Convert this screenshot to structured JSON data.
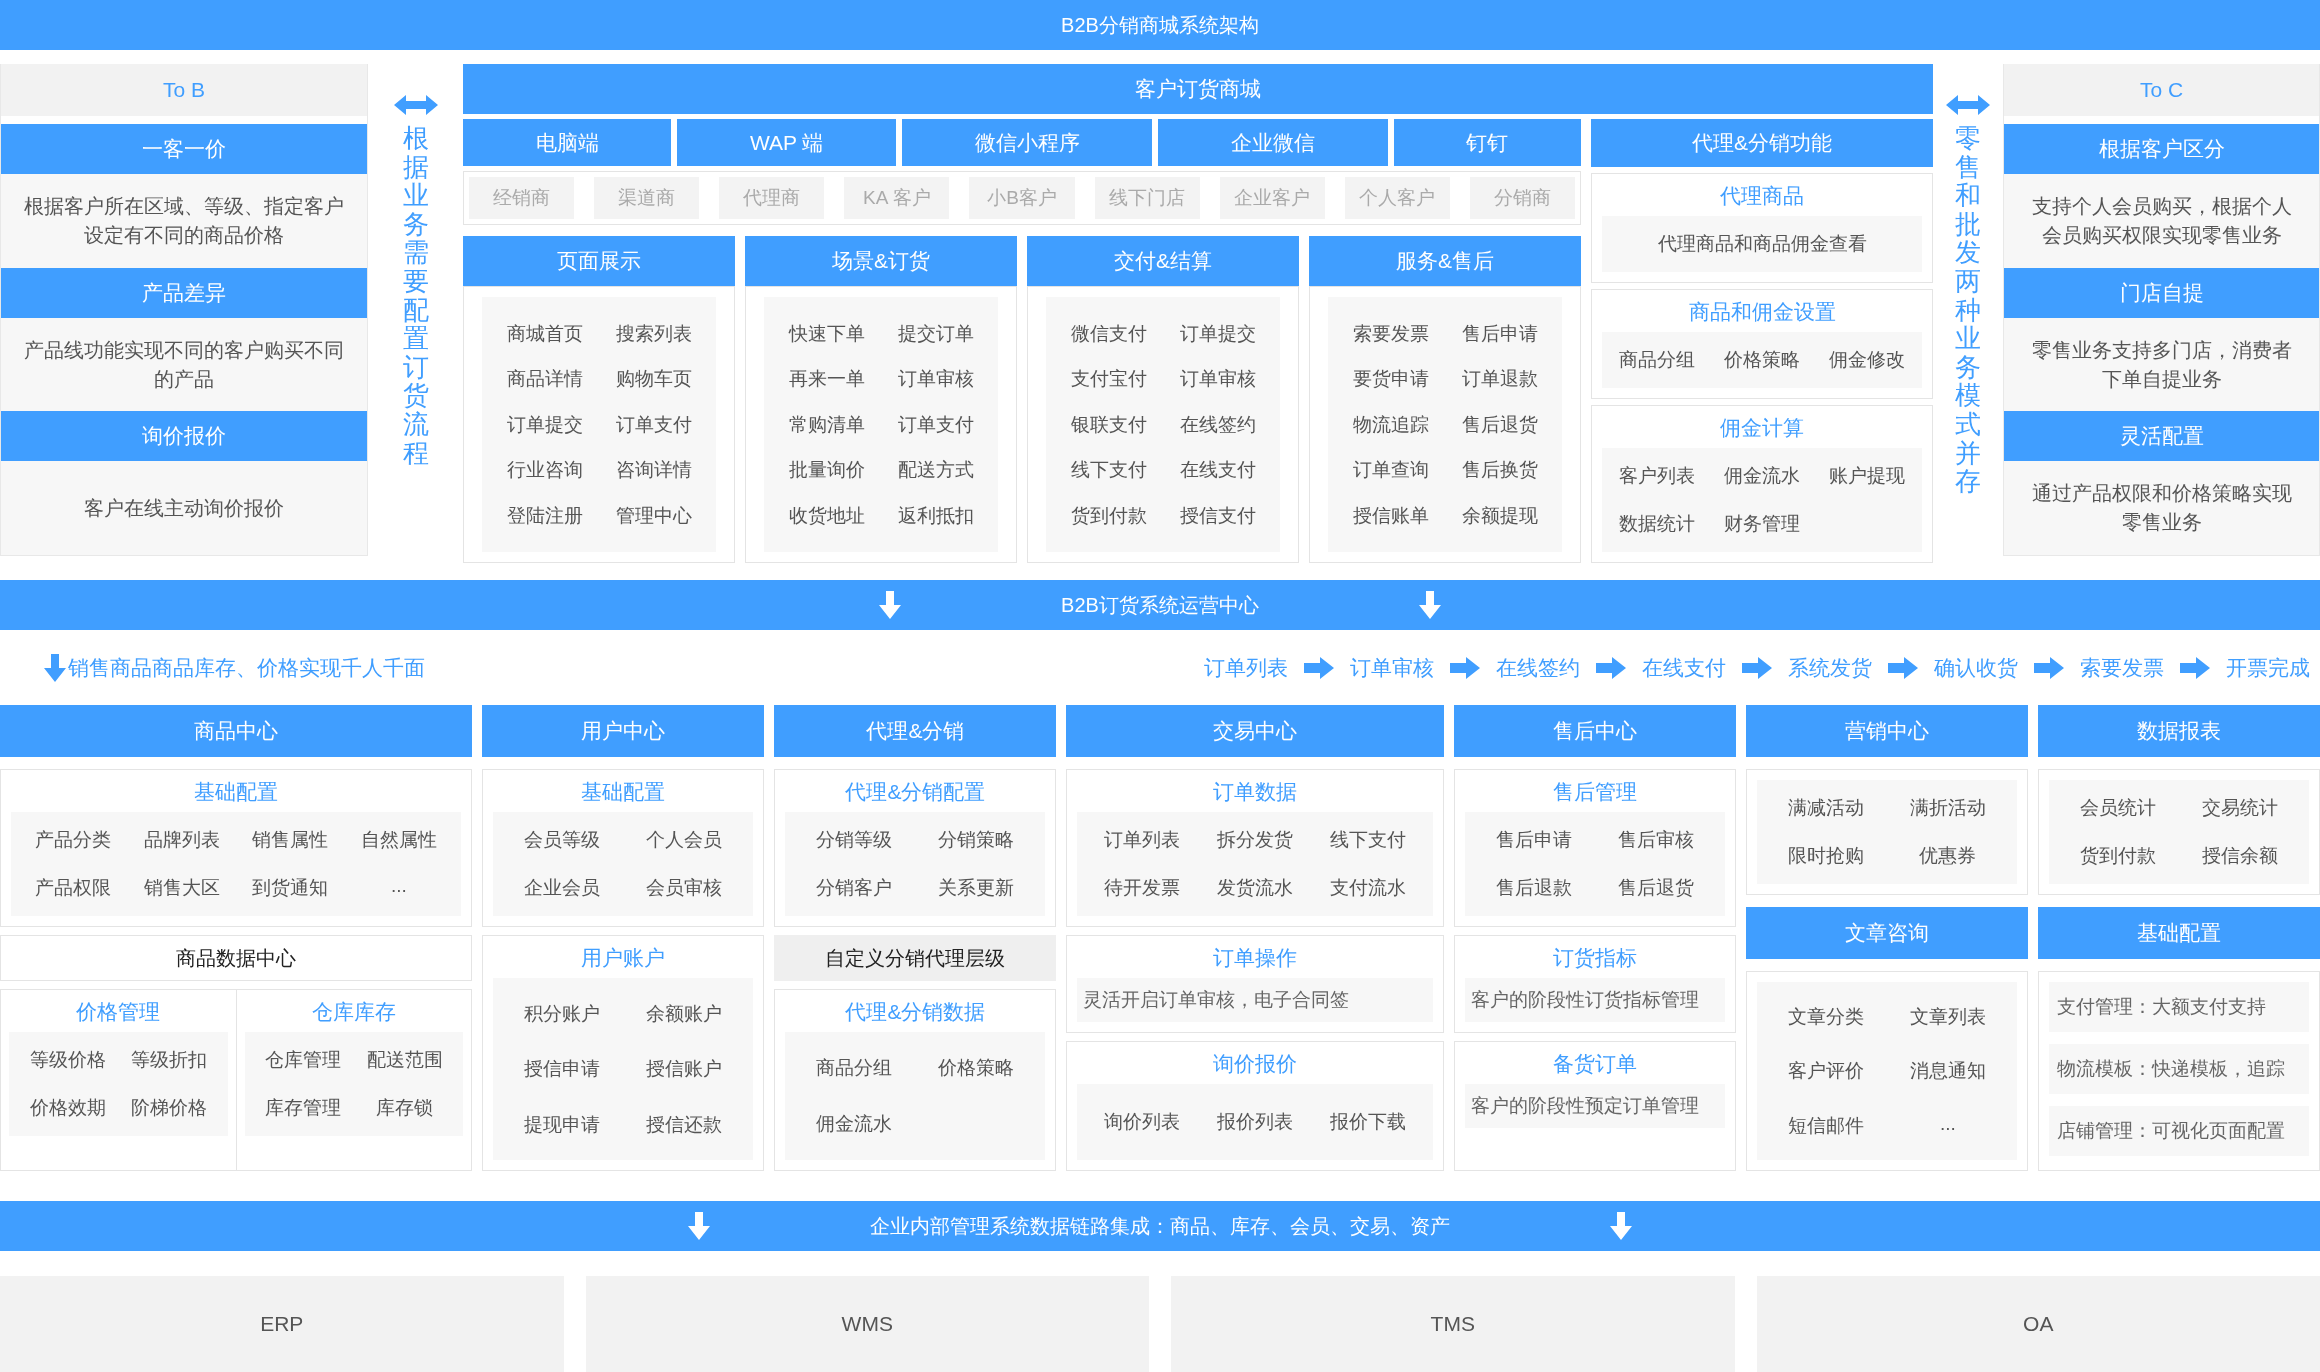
{
  "title": "B2B分销商城系统架构",
  "to_b": {
    "header": "To B",
    "sections": [
      {
        "title": "一客一价",
        "text": "根据客户所在区域、等级、指定客户设定有不同的商品价格"
      },
      {
        "title": "产品差异",
        "text": "产品线功能实现不同的客户购买不同的产品"
      },
      {
        "title": "询价报价",
        "text": "客户在线主动询价报价"
      }
    ]
  },
  "left_note": "根据业务需要配置订货流程",
  "mall": {
    "title": "客户订货商城",
    "channels": [
      "电脑端",
      "WAP 端",
      "微信小程序",
      "企业微信",
      "钉钉"
    ],
    "customer_types": [
      "经销商",
      "渠道商",
      "代理商",
      "KA 客户",
      "小B客户",
      "线下门店",
      "企业客户",
      "个人客户",
      "分销商"
    ],
    "modules": [
      {
        "title": "页面展示",
        "rows": [
          [
            "商城首页",
            "搜索列表"
          ],
          [
            "商品详情",
            "购物车页"
          ],
          [
            "订单提交",
            "订单支付"
          ],
          [
            "行业咨询",
            "咨询详情"
          ],
          [
            "登陆注册",
            "管理中心"
          ]
        ]
      },
      {
        "title": "场景&订货",
        "rows": [
          [
            "快速下单",
            "提交订单"
          ],
          [
            "再来一单",
            "订单审核"
          ],
          [
            "常购清单",
            "订单支付"
          ],
          [
            "批量询价",
            "配送方式"
          ],
          [
            "收货地址",
            "返利抵扣"
          ]
        ]
      },
      {
        "title": "交付&结算",
        "rows": [
          [
            "微信支付",
            "订单提交"
          ],
          [
            "支付宝付",
            "订单审核"
          ],
          [
            "银联支付",
            "在线签约"
          ],
          [
            "线下支付",
            "在线支付"
          ],
          [
            "货到付款",
            "授信支付"
          ]
        ]
      },
      {
        "title": "服务&售后",
        "rows": [
          [
            "索要发票",
            "售后申请"
          ],
          [
            "要货申请",
            "订单退款"
          ],
          [
            "物流追踪",
            "售后退货"
          ],
          [
            "订单查询",
            "售后换货"
          ],
          [
            "授信账单",
            "余额提现"
          ]
        ]
      }
    ],
    "agent": {
      "title": "代理&分销功能",
      "groups": [
        {
          "title": "代理商品",
          "rows": [
            [
              "代理商品和商品佣金查看"
            ]
          ]
        },
        {
          "title": "商品和佣金设置",
          "rows": [
            [
              "商品分组",
              "价格策略",
              "佣金修改"
            ]
          ]
        },
        {
          "title": "佣金计算",
          "rows": [
            [
              "客户列表",
              "佣金流水",
              "账户提现"
            ],
            [
              "数据统计",
              "财务管理"
            ]
          ]
        }
      ]
    }
  },
  "right_note": "零售和批发两种业务模式并存",
  "to_c": {
    "header": "To C",
    "sections": [
      {
        "title": "根据客户区分",
        "text": "支持个人会员购买，根据个人会员购买权限实现零售业务"
      },
      {
        "title": "门店自提",
        "text": "零售业务支持多门店，消费者下单自提业务"
      },
      {
        "title": "灵活配置",
        "text": "通过产品权限和价格策略实现零售业务"
      }
    ]
  },
  "ops_bar": "B2B订货系统运营中心",
  "flow": {
    "note": "销售商品商品库存、价格实现千人千面",
    "steps": [
      "订单列表",
      "订单审核",
      "在线签约",
      "在线支付",
      "系统发货",
      "确认收货",
      "索要发票",
      "开票完成"
    ]
  },
  "centers": [
    {
      "title": "商品中心",
      "blocks": [
        {
          "kind": "group",
          "title": "基础配置",
          "rows": [
            [
              "产品分类",
              "品牌列表",
              "销售属性",
              "自然属性"
            ],
            [
              "产品权限",
              "销售大区",
              "到货通知",
              "..."
            ]
          ]
        },
        {
          "kind": "label",
          "text": "商品数据中心"
        },
        {
          "kind": "split",
          "groups": [
            {
              "title": "价格管理",
              "rows": [
                [
                  "等级价格",
                  "等级折扣"
                ],
                [
                  "价格效期",
                  "阶梯价格"
                ]
              ]
            },
            {
              "title": "仓库库存",
              "rows": [
                [
                  "仓库管理",
                  "配送范围"
                ],
                [
                  "库存管理",
                  "库存锁"
                ]
              ]
            }
          ]
        }
      ]
    },
    {
      "title": "用户中心",
      "blocks": [
        {
          "kind": "group",
          "title": "基础配置",
          "rows": [
            [
              "会员等级",
              "个人会员"
            ],
            [
              "企业会员",
              "会员审核"
            ]
          ]
        },
        {
          "kind": "group",
          "title": "用户账户",
          "rows": [
            [
              "积分账户",
              "余额账户"
            ],
            [
              "授信申请",
              "授信账户"
            ],
            [
              "提现申请",
              "授信还款"
            ]
          ]
        }
      ]
    },
    {
      "title": "代理&分销",
      "blocks": [
        {
          "kind": "group",
          "title": "代理&分销配置",
          "rows": [
            [
              "分销等级",
              "分销策略"
            ],
            [
              "分销客户",
              "关系更新"
            ]
          ]
        },
        {
          "kind": "shaded_label",
          "text": "自定义分销代理层级"
        },
        {
          "kind": "group",
          "title": "代理&分销数据",
          "rows": [
            [
              "商品分组",
              "价格策略"
            ],
            [
              "佣金流水"
            ]
          ]
        }
      ]
    },
    {
      "title": "交易中心",
      "blocks": [
        {
          "kind": "group",
          "title": "订单数据",
          "rows": [
            [
              "订单列表",
              "拆分发货",
              "线下支付"
            ],
            [
              "待开发票",
              "发货流水",
              "支付流水"
            ]
          ]
        },
        {
          "kind": "note",
          "title": "订单操作",
          "text": "灵活开启订单审核，电子合同签"
        },
        {
          "kind": "group",
          "title": "询价报价",
          "rows": [
            [
              "询价列表",
              "报价列表",
              "报价下载"
            ]
          ]
        }
      ]
    },
    {
      "title": "售后中心",
      "blocks": [
        {
          "kind": "group",
          "title": "售后管理",
          "rows": [
            [
              "售后申请",
              "售后审核"
            ],
            [
              "售后退款",
              "售后退货"
            ]
          ]
        },
        {
          "kind": "note",
          "title": "订货指标",
          "text": "客户的阶段性订货指标管理"
        },
        {
          "kind": "note",
          "title": "备货订单",
          "text": "客户的阶段性预定订单管理"
        }
      ]
    },
    {
      "title": "营销中心",
      "blocks": [
        {
          "kind": "group",
          "rows": [
            [
              "满减活动",
              "满折活动"
            ],
            [
              "限时抢购",
              "优惠券"
            ]
          ]
        },
        {
          "kind": "header",
          "text": "文章咨询"
        },
        {
          "kind": "group",
          "rows": [
            [
              "文章分类",
              "文章列表"
            ],
            [
              "客户评价",
              "消息通知"
            ],
            [
              "短信邮件",
              "..."
            ]
          ]
        }
      ]
    },
    {
      "title": "数据报表",
      "blocks": [
        {
          "kind": "group",
          "rows": [
            [
              "会员统计",
              "交易统计"
            ],
            [
              "货到付款",
              "授信余额"
            ]
          ]
        },
        {
          "kind": "header",
          "text": "基础配置"
        },
        {
          "kind": "list",
          "items": [
            "支付管理：大额支付支持",
            "物流模板：快递模板，追踪",
            "店铺管理：可视化页面配置"
          ]
        }
      ]
    }
  ],
  "integration_bar": "企业内部管理系统数据链路集成：商品、库存、会员、交易、资产",
  "systems": [
    "ERP",
    "WMS",
    "TMS",
    "OA"
  ]
}
